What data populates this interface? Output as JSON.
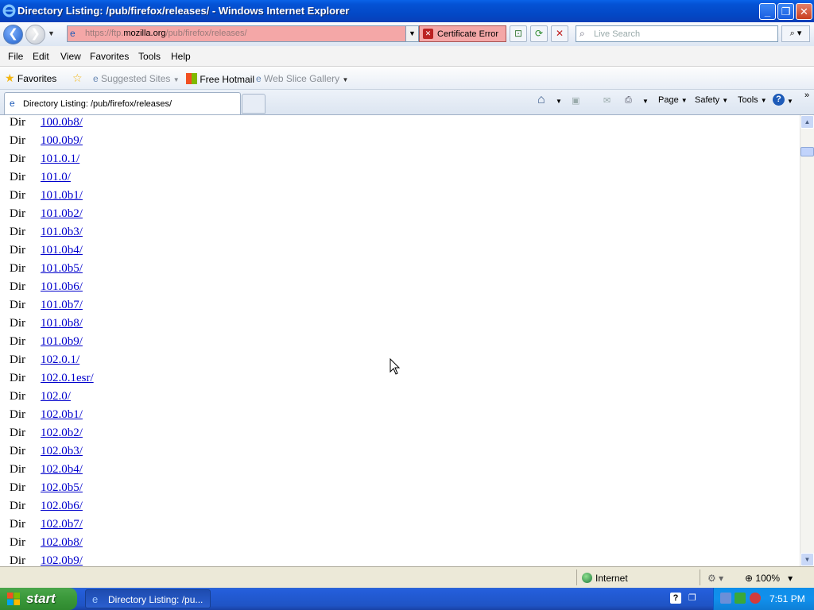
{
  "window": {
    "title": "Directory Listing: /pub/firefox/releases/ - Windows Internet Explorer",
    "minimize": "_",
    "maximize": "❐",
    "close": "✕"
  },
  "address": {
    "url_scheme": "https://ftp.",
    "url_host": "mozilla.org",
    "url_path": "/pub/firefox/releases/",
    "cert_error": "Certificate Error",
    "search_placeholder": "Live Search"
  },
  "menu": [
    "File",
    "Edit",
    "View",
    "Favorites",
    "Tools",
    "Help"
  ],
  "favorites_bar": {
    "favorites": "Favorites",
    "suggested": "Suggested Sites",
    "hotmail": "Free Hotmail",
    "gallery": "Web Slice Gallery"
  },
  "tab": {
    "label": "Directory Listing: /pub/firefox/releases/"
  },
  "commands": {
    "page": "Page",
    "safety": "Safety",
    "tools": "Tools"
  },
  "listing": [
    {
      "type": "Dir",
      "name": "100.0b8/"
    },
    {
      "type": "Dir",
      "name": "100.0b9/"
    },
    {
      "type": "Dir",
      "name": "101.0.1/"
    },
    {
      "type": "Dir",
      "name": "101.0/"
    },
    {
      "type": "Dir",
      "name": "101.0b1/"
    },
    {
      "type": "Dir",
      "name": "101.0b2/"
    },
    {
      "type": "Dir",
      "name": "101.0b3/"
    },
    {
      "type": "Dir",
      "name": "101.0b4/"
    },
    {
      "type": "Dir",
      "name": "101.0b5/"
    },
    {
      "type": "Dir",
      "name": "101.0b6/"
    },
    {
      "type": "Dir",
      "name": "101.0b7/"
    },
    {
      "type": "Dir",
      "name": "101.0b8/"
    },
    {
      "type": "Dir",
      "name": "101.0b9/"
    },
    {
      "type": "Dir",
      "name": "102.0.1/"
    },
    {
      "type": "Dir",
      "name": "102.0.1esr/"
    },
    {
      "type": "Dir",
      "name": "102.0/"
    },
    {
      "type": "Dir",
      "name": "102.0b1/"
    },
    {
      "type": "Dir",
      "name": "102.0b2/"
    },
    {
      "type": "Dir",
      "name": "102.0b3/"
    },
    {
      "type": "Dir",
      "name": "102.0b4/"
    },
    {
      "type": "Dir",
      "name": "102.0b5/"
    },
    {
      "type": "Dir",
      "name": "102.0b6/"
    },
    {
      "type": "Dir",
      "name": "102.0b7/"
    },
    {
      "type": "Dir",
      "name": "102.0b8/"
    },
    {
      "type": "Dir",
      "name": "102.0b9/"
    }
  ],
  "status": {
    "zone": "Internet",
    "zoom": "100%"
  },
  "taskbar": {
    "start": "start",
    "window_item": "Directory Listing: /pu...",
    "clock": "7:51 PM"
  }
}
